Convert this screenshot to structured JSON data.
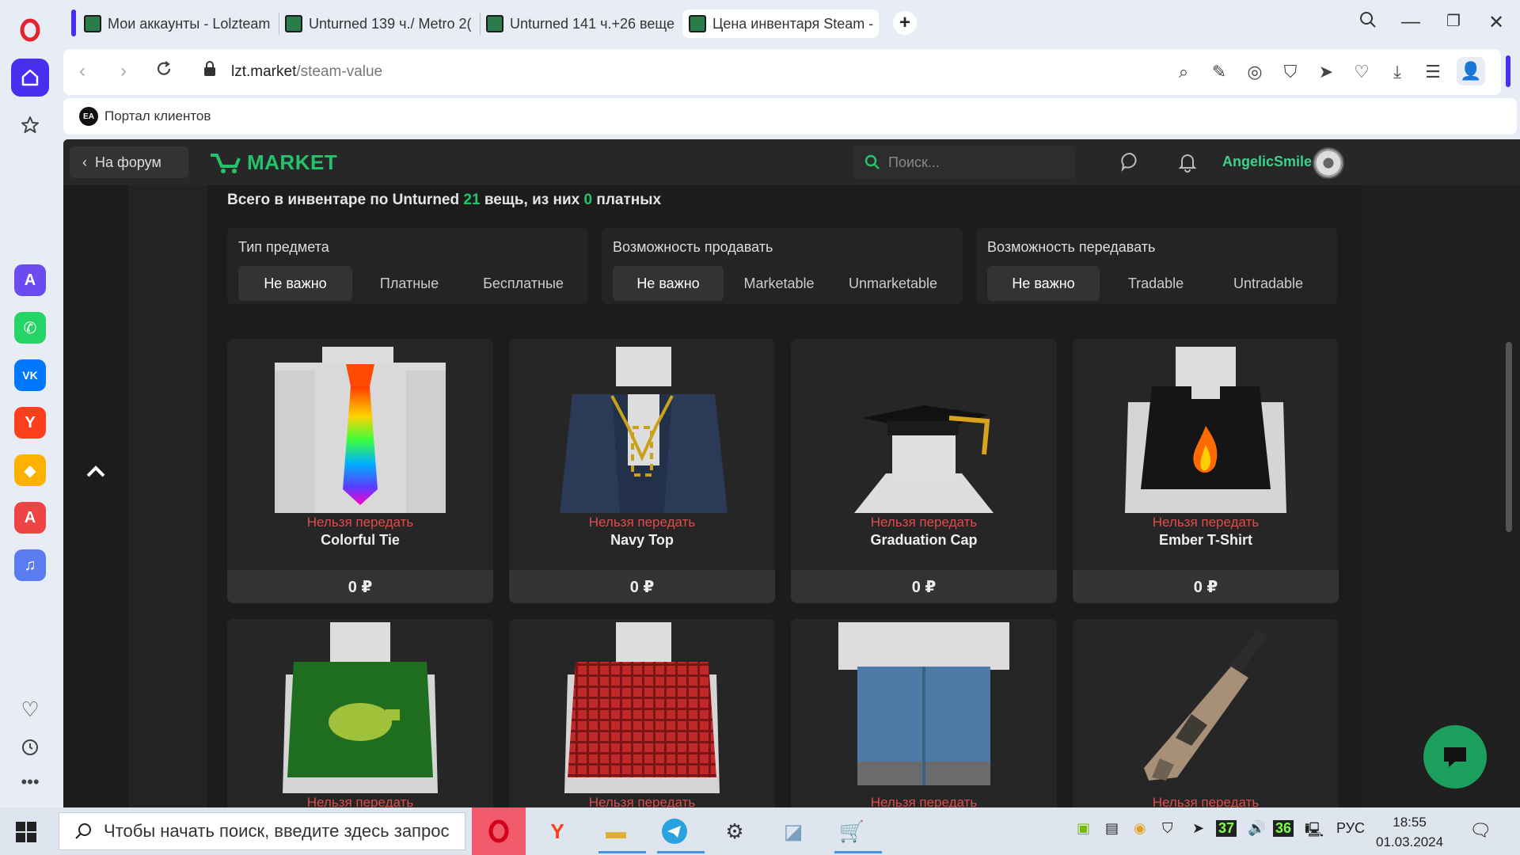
{
  "browser": {
    "tabs": [
      {
        "label": "Мои аккаунты - Lolzteam"
      },
      {
        "label": "Unturned 139 ч./ Metro 2("
      },
      {
        "label": "Unturned 141 ч.+26 веще"
      },
      {
        "label": "Цена инвентаря Steam -"
      }
    ],
    "new_tab": "+",
    "url_host": "lzt.market",
    "url_path": "/steam-value",
    "bookmark": {
      "badge": "EA",
      "label": "Портал клиентов"
    }
  },
  "site": {
    "back_label": "На форум",
    "logo": "MARKET",
    "search_placeholder": "Поиск...",
    "username": "AngelicSmile",
    "summary": {
      "prefix": "Всего в инвентаре по Unturned",
      "total": "21",
      "middle": "вещь, из них",
      "paid": "0",
      "suffix": "платных"
    },
    "filters": [
      {
        "title": "Тип предмета",
        "options": [
          "Не важно",
          "Платные",
          "Бесплатные"
        ],
        "selected": 0
      },
      {
        "title": "Возможность продавать",
        "options": [
          "Не важно",
          "Marketable",
          "Unmarketable"
        ],
        "selected": 0
      },
      {
        "title": "Возможность передавать",
        "options": [
          "Не важно",
          "Tradable",
          "Untradable"
        ],
        "selected": 0
      }
    ],
    "items": [
      {
        "status": "Нельзя передать",
        "name": "Colorful Tie",
        "price": "0 ₽"
      },
      {
        "status": "Нельзя передать",
        "name": "Navy Top",
        "price": "0 ₽"
      },
      {
        "status": "Нельзя передать",
        "name": "Graduation Cap",
        "price": "0 ₽"
      },
      {
        "status": "Нельзя передать",
        "name": "Ember T-Shirt",
        "price": "0 ₽"
      },
      {
        "status": "Нельзя передать"
      },
      {
        "status": "Нельзя передать"
      },
      {
        "status": "Нельзя передать"
      },
      {
        "status": "Нельзя передать"
      }
    ]
  },
  "taskbar": {
    "search_placeholder": "Чтобы начать поиск, введите здесь запрос",
    "tray_num_1": "37",
    "tray_num_2": "36",
    "lang": "РУС",
    "time": "18:55",
    "date": "01.03.2024"
  },
  "colors": {
    "accent": "#25c36b",
    "danger": "#e04b4b",
    "bg": "#1c1c1c"
  }
}
